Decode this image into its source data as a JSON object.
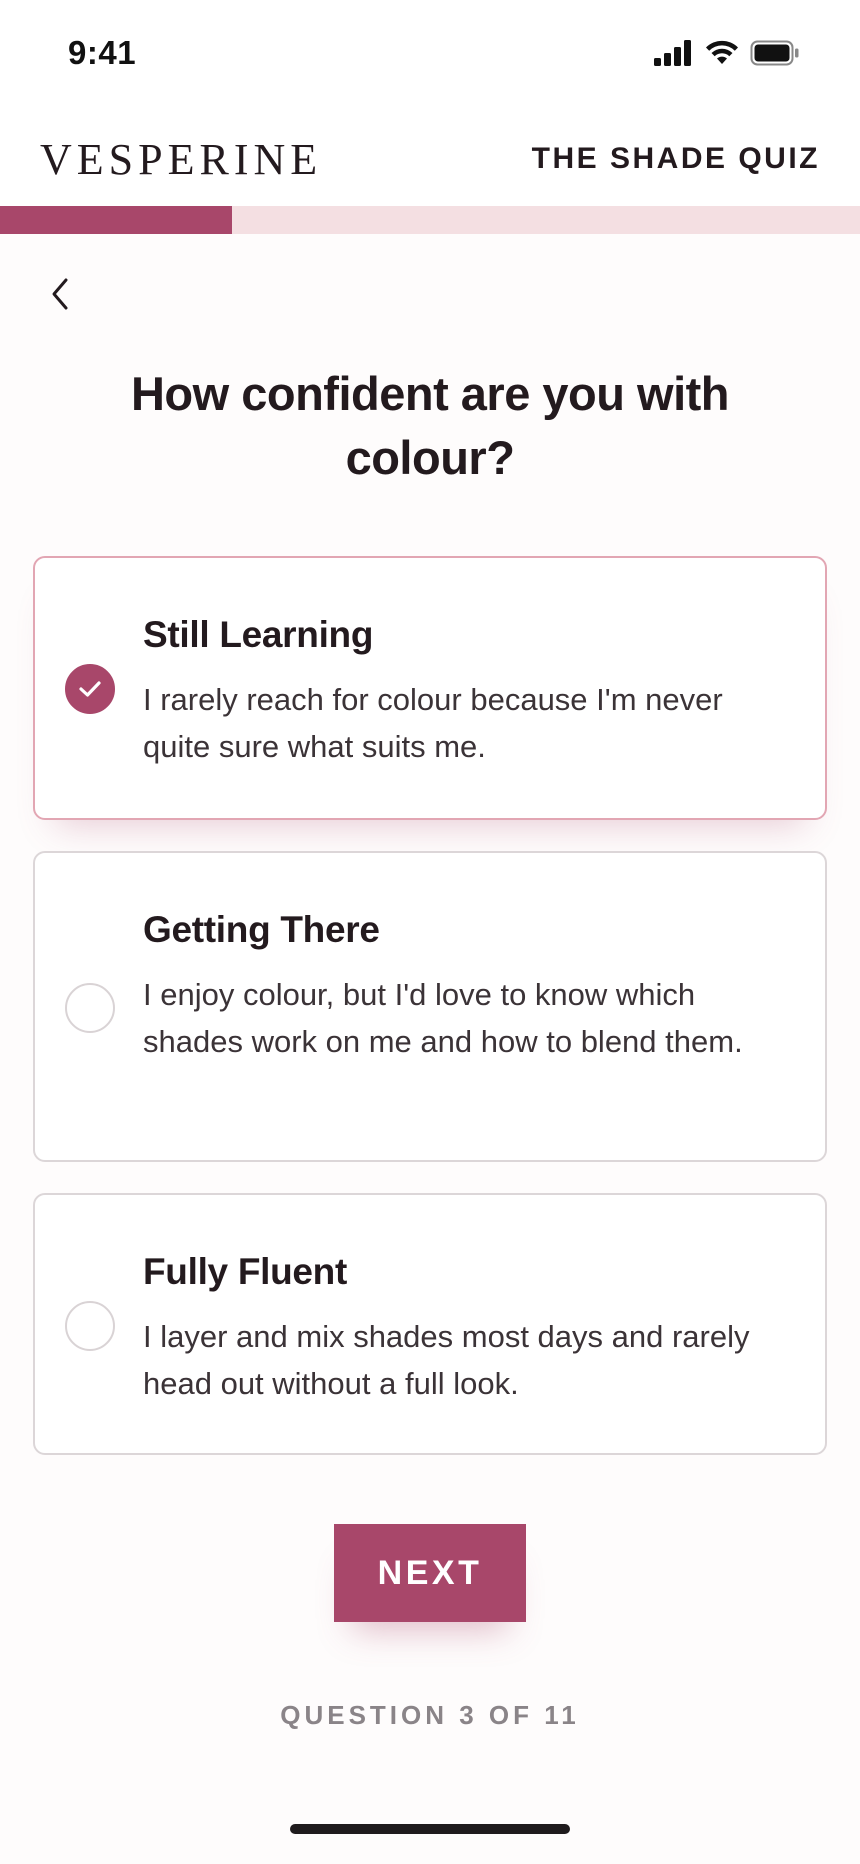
{
  "status_bar": {
    "time": "9:41",
    "icons": [
      "signal-icon",
      "wifi-icon",
      "battery-icon"
    ]
  },
  "header": {
    "brand": "VESPERINE",
    "quiz_title": "THE SHADE QUIZ"
  },
  "progress": {
    "current": 3,
    "total": 11,
    "fraction": 0.27,
    "fill_color": "#a8476a",
    "track_color": "#f4dfe2"
  },
  "nav": {
    "back_icon": "chevron-left-icon"
  },
  "question": "How confident are you with colour?",
  "options": [
    {
      "title": "Still Learning",
      "description": "I rarely reach for colour because I'm never quite sure what suits me.",
      "selected": true
    },
    {
      "title": "Getting There",
      "description": "I enjoy colour, but I'd love to know which shades work on me and how to blend them.",
      "selected": false
    },
    {
      "title": "Fully Fluent",
      "description": "I layer and mix shades most days and rarely head out without a full look.",
      "selected": false
    }
  ],
  "next_button": "NEXT",
  "counter": "QUESTION 3 OF 11",
  "colors": {
    "accent": "#a8476a",
    "selected_border": "#e2a6b3",
    "text": "#231a1e"
  }
}
